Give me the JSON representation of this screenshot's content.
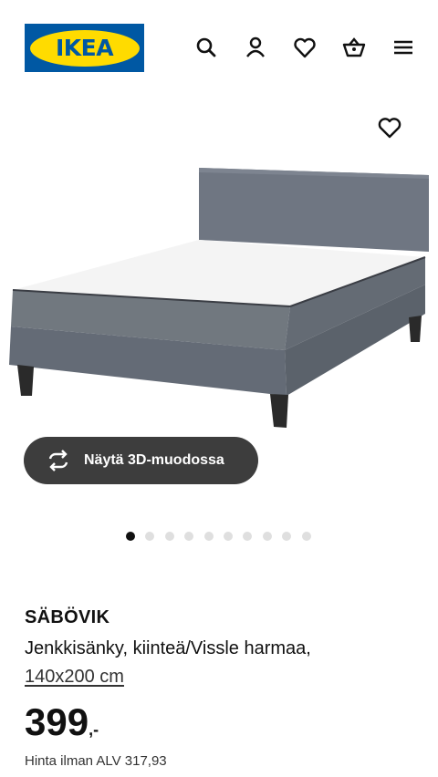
{
  "header": {
    "logo_text": "IKEA",
    "icons": [
      "search-icon",
      "user-icon",
      "heart-icon",
      "basket-icon",
      "menu-icon"
    ]
  },
  "gallery": {
    "favorite_icon": "heart-icon",
    "view_3d_label": "Näytä 3D-muodossa",
    "image_count": 10,
    "active_image": 1
  },
  "product": {
    "name": "SÄBÖVIK",
    "description": "Jenkkisänky, kiinteä/Vissle harmaa,",
    "size": "140x200 cm",
    "price_main": "399",
    "price_suffix": ",-",
    "vat_text": "Hinta ilman ALV 317,93"
  },
  "colors": {
    "ikea_blue": "#0058a3",
    "ikea_yellow": "#ffdb00",
    "button_dark": "#3d3d3d",
    "bed_gray": "#6f7682"
  }
}
